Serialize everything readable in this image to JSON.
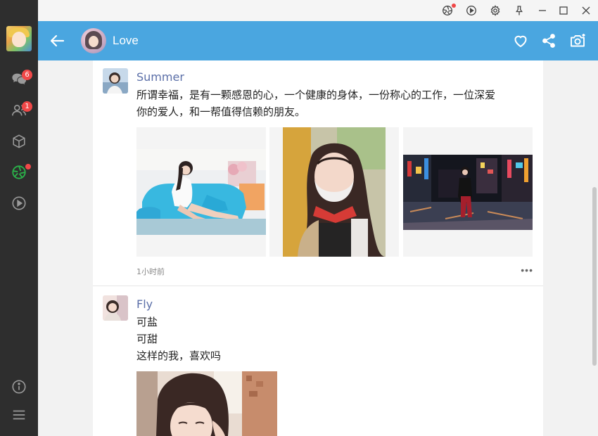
{
  "sidebar": {
    "chat_badge": "6",
    "contacts_badge": "1",
    "icons": [
      "chat-icon",
      "contacts-icon",
      "box-icon",
      "moments-icon",
      "play-icon",
      "info-icon",
      "menu-icon"
    ]
  },
  "titlebar": {
    "icons": [
      "mini-program-icon",
      "video-icon",
      "settings-icon",
      "pin-icon",
      "minimize-icon",
      "maximize-icon",
      "close-icon"
    ]
  },
  "header": {
    "title": "Love",
    "icons": [
      "back-arrow-icon",
      "heart-icon",
      "share-icon",
      "camera-icon"
    ],
    "bg_color": "#4aa6e0"
  },
  "posts": [
    {
      "author": "Summer",
      "lines": [
        "所谓幸福，是有一颗感恩的心，一个健康的身体，一份称心的工作，一位深爱",
        "你的爱人，和一帮值得信赖的朋友。"
      ],
      "time": "1小时前",
      "photos": [
        "woman-on-blue-sofa",
        "woman-with-mask-selfie",
        "woman-on-neon-street"
      ]
    },
    {
      "author": "Fly",
      "lines": [
        "可盐",
        "可甜",
        "这样的我，喜欢吗"
      ],
      "photos": [
        "woman-selfie"
      ]
    }
  ],
  "colors": {
    "sidebar": "#2e2e2e",
    "badge": "#f04848",
    "accent_green": "#2bb34a",
    "author_link": "#5b6fa8"
  }
}
